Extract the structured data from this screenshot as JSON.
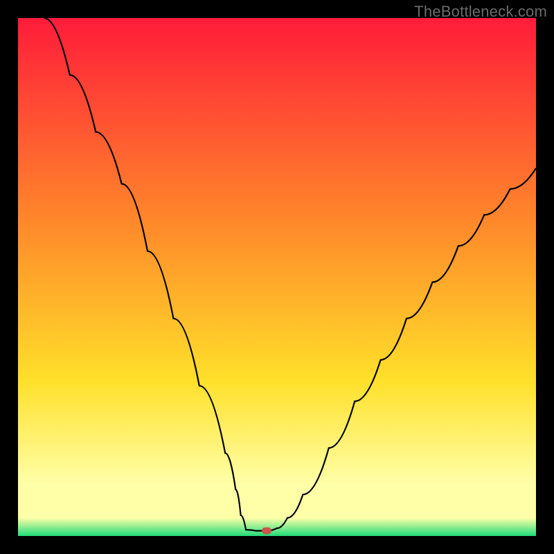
{
  "watermark": "TheBottleneck.com",
  "chart_data": {
    "type": "line",
    "title": "",
    "xlabel": "",
    "ylabel": "",
    "xlim": [
      0,
      100
    ],
    "ylim": [
      0,
      100
    ],
    "gradient_colors": {
      "top": "#ff1c3a",
      "mid1": "#ff8a2a",
      "mid2": "#ffe02a",
      "mid3": "#ffffa8",
      "bottom": "#1edc78"
    },
    "curve_points": [
      {
        "x": 5,
        "y": 100
      },
      {
        "x": 10,
        "y": 89
      },
      {
        "x": 15,
        "y": 78
      },
      {
        "x": 20,
        "y": 68
      },
      {
        "x": 25,
        "y": 55
      },
      {
        "x": 30,
        "y": 42
      },
      {
        "x": 35,
        "y": 29
      },
      {
        "x": 40,
        "y": 16
      },
      {
        "x": 42,
        "y": 9
      },
      {
        "x": 43,
        "y": 4
      },
      {
        "x": 44,
        "y": 1.2
      },
      {
        "x": 46,
        "y": 1.0
      },
      {
        "x": 48,
        "y": 1.0
      },
      {
        "x": 50,
        "y": 1.5
      },
      {
        "x": 52,
        "y": 3.5
      },
      {
        "x": 55,
        "y": 8
      },
      {
        "x": 60,
        "y": 17
      },
      {
        "x": 65,
        "y": 26
      },
      {
        "x": 70,
        "y": 34
      },
      {
        "x": 75,
        "y": 42
      },
      {
        "x": 80,
        "y": 49
      },
      {
        "x": 85,
        "y": 56
      },
      {
        "x": 90,
        "y": 62
      },
      {
        "x": 95,
        "y": 67
      },
      {
        "x": 100,
        "y": 71
      }
    ],
    "marker": {
      "x": 48,
      "y": 1.0,
      "color": "#c9554b"
    },
    "curve_stroke": "#000000"
  }
}
